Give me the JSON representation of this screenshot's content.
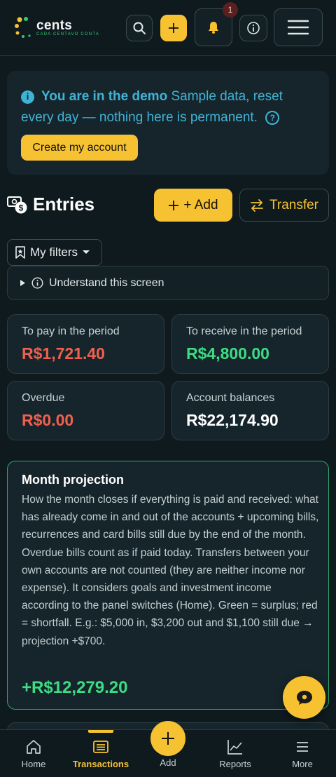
{
  "header": {
    "brand": "cents",
    "tagline": "CADA CENTAVO CONTA",
    "notification_count": "1"
  },
  "demo": {
    "title": "You are in the demo",
    "message": "Sample data, reset every day — nothing here is permanent.",
    "cta": "Create my account"
  },
  "entries": {
    "title": "Entries",
    "add_label": "+ Add",
    "transfer_label": "Transfer",
    "filters_label": "My filters",
    "understand_label": "Understand this screen"
  },
  "summary": {
    "to_pay_label": "To pay in the period",
    "to_pay_value": "R$1,721.40",
    "to_receive_label": "To receive in the period",
    "to_receive_value": "R$4,800.00",
    "overdue_label": "Overdue",
    "overdue_value": "R$0.00",
    "balances_label": "Account balances",
    "balances_value": "R$22,174.90"
  },
  "projection": {
    "title": "Month projection",
    "description": "How the month closes if everything is paid and received: what has already come in and out of the accounts + upcoming bills, recurrences and card bills still due by the end of the month. Overdue bills count as if paid today. Transfers between your own accounts are not counted (they are neither income nor expense). It considers goals and investment income according to the panel switches (Home). Green = surplus; red = shortfall. E.g.: $5,000 in, $3,200 out and $1,100 still due → projection +$700.",
    "value": "+R$12,279.20"
  },
  "nav": {
    "home": "Home",
    "transactions": "Transactions",
    "add": "Add",
    "reports": "Reports",
    "more": "More"
  },
  "colors": {
    "accent": "#f7c232",
    "negative": "#f0604f",
    "positive": "#3ddc84",
    "info": "#3fb3d6",
    "background": "#0f1a1e",
    "card": "#16252b"
  }
}
